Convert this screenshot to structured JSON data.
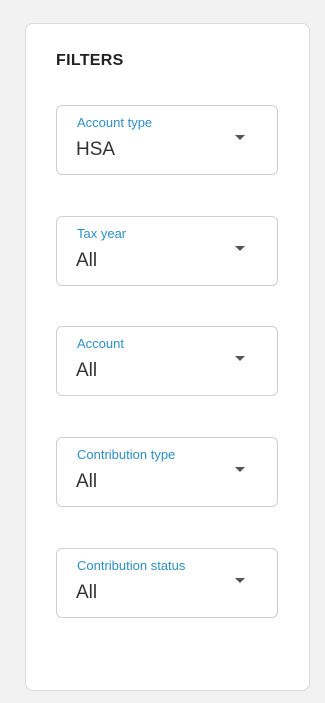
{
  "filters": {
    "title": "FILTERS",
    "account_type": {
      "label": "Account type",
      "value": "HSA"
    },
    "tax_year": {
      "label": "Tax year",
      "value": "All"
    },
    "account": {
      "label": "Account",
      "value": "All"
    },
    "contribution_type": {
      "label": "Contribution type",
      "value": "All"
    },
    "contribution_status": {
      "label": "Contribution status",
      "value": "All"
    }
  },
  "icons": {
    "dropdown": "caret-down-icon"
  },
  "colors": {
    "background": "#f2f2f2",
    "panel": "#ffffff",
    "label_accent": "#2f8fc4",
    "value_text": "#333333",
    "border": "#cfcfcf"
  }
}
